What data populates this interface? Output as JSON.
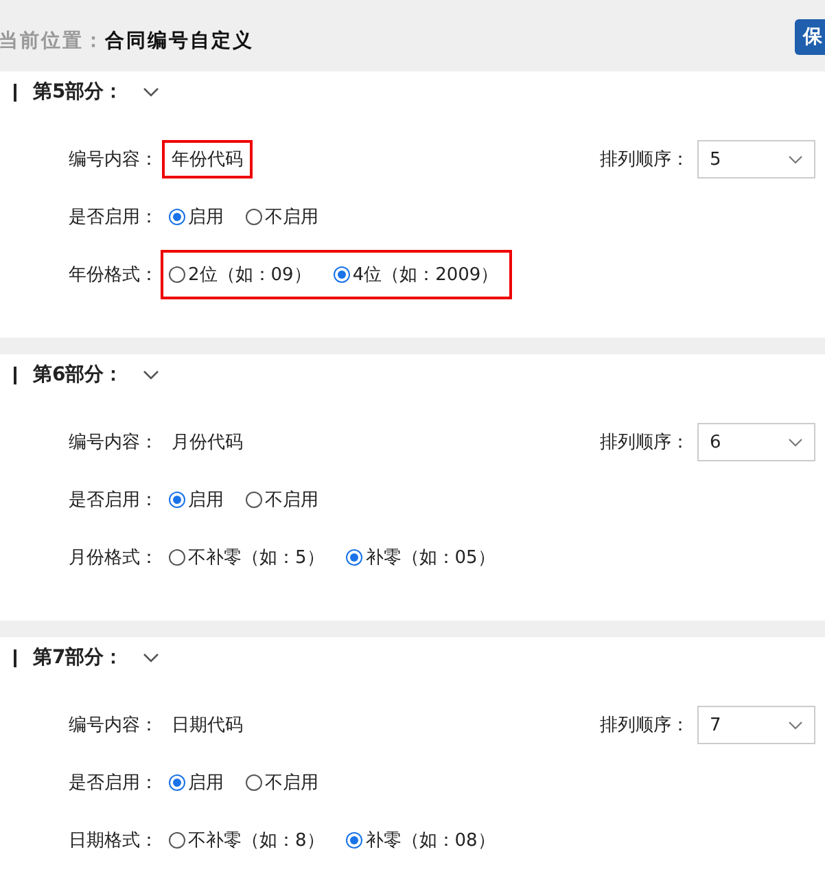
{
  "breadcrumb": {
    "label": "当前位置：",
    "current": "合同编号自定义"
  },
  "save_button": "保",
  "sections": [
    {
      "title": "第5部分：",
      "content_label": "编号内容：",
      "content": "年份代码",
      "content_highlighted": true,
      "order_label": "排列顺序：",
      "order": "5",
      "enable_label": "是否启用：",
      "enable_options": [
        {
          "label": "启用",
          "selected": true
        },
        {
          "label": "不启用",
          "selected": false
        }
      ],
      "format_label": "年份格式：",
      "format_highlighted": true,
      "format_options": [
        {
          "label": "2位（如：09）",
          "selected": false
        },
        {
          "label": "4位（如：2009）",
          "selected": true
        }
      ]
    },
    {
      "title": "第6部分：",
      "content_label": "编号内容：",
      "content": "月份代码",
      "content_highlighted": false,
      "order_label": "排列顺序：",
      "order": "6",
      "enable_label": "是否启用：",
      "enable_options": [
        {
          "label": "启用",
          "selected": true
        },
        {
          "label": "不启用",
          "selected": false
        }
      ],
      "format_label": "月份格式：",
      "format_highlighted": false,
      "format_options": [
        {
          "label": "不补零（如：5）",
          "selected": false
        },
        {
          "label": "补零（如：05）",
          "selected": true
        }
      ]
    },
    {
      "title": "第7部分：",
      "content_label": "编号内容：",
      "content": "日期代码",
      "content_highlighted": false,
      "order_label": "排列顺序：",
      "order": "7",
      "enable_label": "是否启用：",
      "enable_options": [
        {
          "label": "启用",
          "selected": true
        },
        {
          "label": "不启用",
          "selected": false
        }
      ],
      "format_label": "日期格式：",
      "format_highlighted": false,
      "format_options": [
        {
          "label": "不补零（如：8）",
          "selected": false
        },
        {
          "label": "补零（如：08）",
          "selected": true
        }
      ]
    }
  ]
}
